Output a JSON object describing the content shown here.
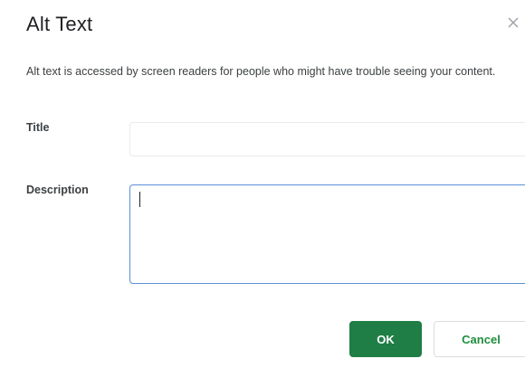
{
  "dialog": {
    "title": "Alt Text",
    "close_icon": "close-icon",
    "description": "Alt text is accessed by screen readers for people who might have trouble seeing your content.",
    "fields": {
      "title_label": "Title",
      "title_value": "",
      "description_label": "Description",
      "description_value": ""
    },
    "buttons": {
      "ok_label": "OK",
      "cancel_label": "Cancel"
    },
    "colors": {
      "primary": "#1e7e45",
      "focus_border": "#5b8fd9"
    }
  }
}
